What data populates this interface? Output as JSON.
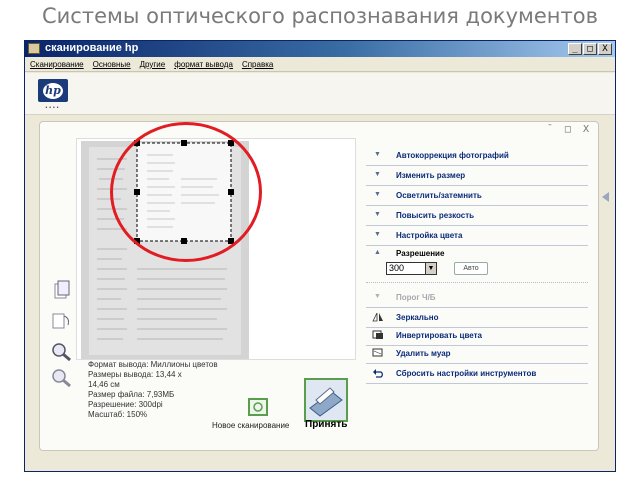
{
  "slide": {
    "title": "Системы оптического распознавания документов"
  },
  "window": {
    "title": "сканирование hp",
    "buttons": {
      "minimize": "_",
      "maximize": "□",
      "close": "X"
    }
  },
  "menu": [
    "Сканирование",
    "Основные",
    "Другие",
    "формат вывода",
    "Справка"
  ],
  "pane_controls": "¯ □ X",
  "info": {
    "line1": "Формат вывода: Миллионы цветов",
    "line2": "Размеры вывода: 13,44 x",
    "line3": "14,46 см",
    "line4": "Размер файла: 7,93МБ",
    "line5": "Разрешение: 300dpi",
    "line6": "Масштаб: 150%"
  },
  "actions": {
    "rescan_label": "Новое сканирование",
    "accept_label": "Принять"
  },
  "tasks": [
    {
      "label": "Автокоррекция фотографий"
    },
    {
      "label": "Изменить размер"
    },
    {
      "label": "Осветлить/затемнить"
    },
    {
      "label": "Повысить резкость"
    },
    {
      "label": "Настройка цвета"
    },
    {
      "label": "Разрешение"
    },
    {
      "label": "Порог Ч/Б"
    },
    {
      "label": "Зеркально"
    },
    {
      "label": "Инвертировать цвета"
    },
    {
      "label": "Удалить муар"
    },
    {
      "label": "Сбросить настройки инструментов"
    }
  ],
  "resolution": {
    "value": "300",
    "auto_label": "Авто"
  },
  "colors": {
    "accent": "#0b2b7a",
    "highlight": "#e11c22",
    "frame_green": "#5a9e4d"
  }
}
